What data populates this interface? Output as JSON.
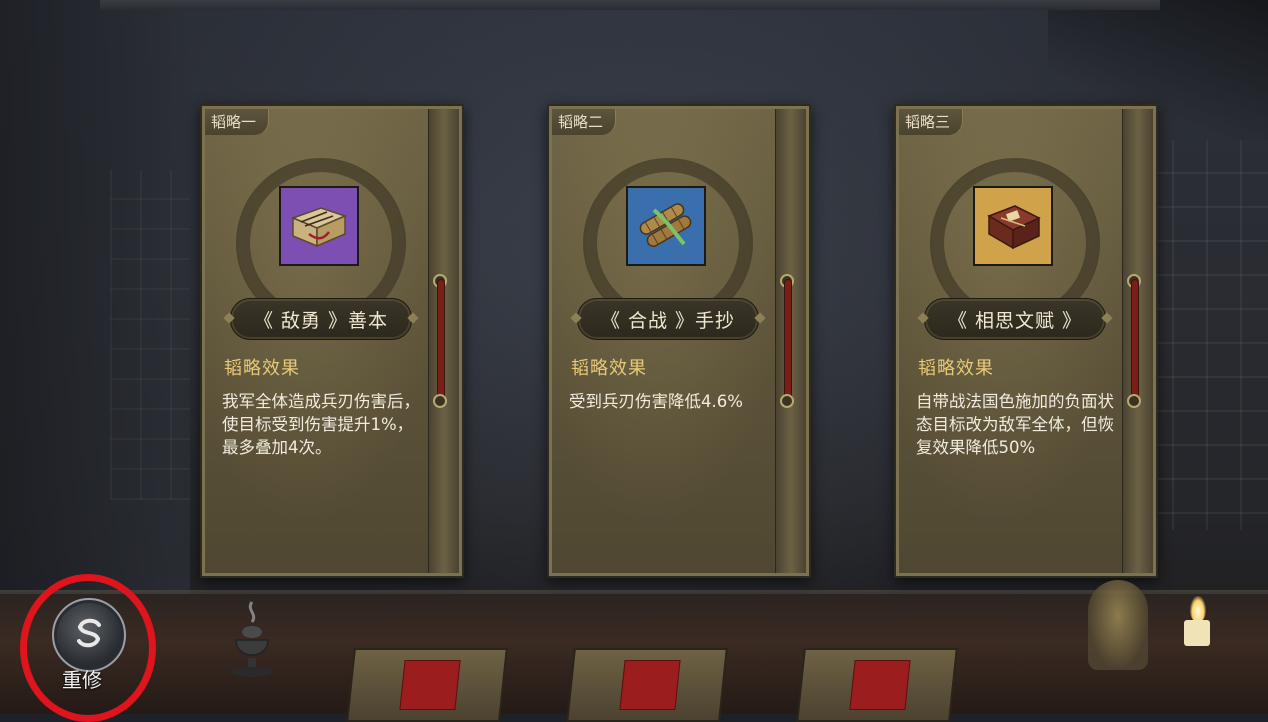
{
  "cards": [
    {
      "tab": "韬略一",
      "name": "《 敌勇 》善本",
      "effect_title": "韬略效果",
      "effect_desc": "我军全体造成兵刃伤害后，使目标受到伤害提升1%，最多叠加4次。",
      "icon": "scroll-book-icon",
      "icon_bg": "#7d4fb3"
    },
    {
      "tab": "韬略二",
      "name": "《 合战 》手抄",
      "effect_title": "韬略效果",
      "effect_desc": "受到兵刃伤害降低4.6%",
      "icon": "bamboo-scroll-icon",
      "icon_bg": "#3a6fae"
    },
    {
      "tab": "韬略三",
      "name": "《 相思文赋 》",
      "effect_title": "韬略效果",
      "effect_desc": "自带战法国色施加的负面状态目标改为敌军全体，但恢复效果降低50%",
      "icon": "bound-book-icon",
      "icon_bg": "#d0a24a"
    }
  ],
  "reset_button": {
    "label": "重修",
    "icon": "refresh-icon"
  },
  "colors": {
    "highlight_circle": "#e0141c",
    "effect_title": "#e7c977"
  }
}
